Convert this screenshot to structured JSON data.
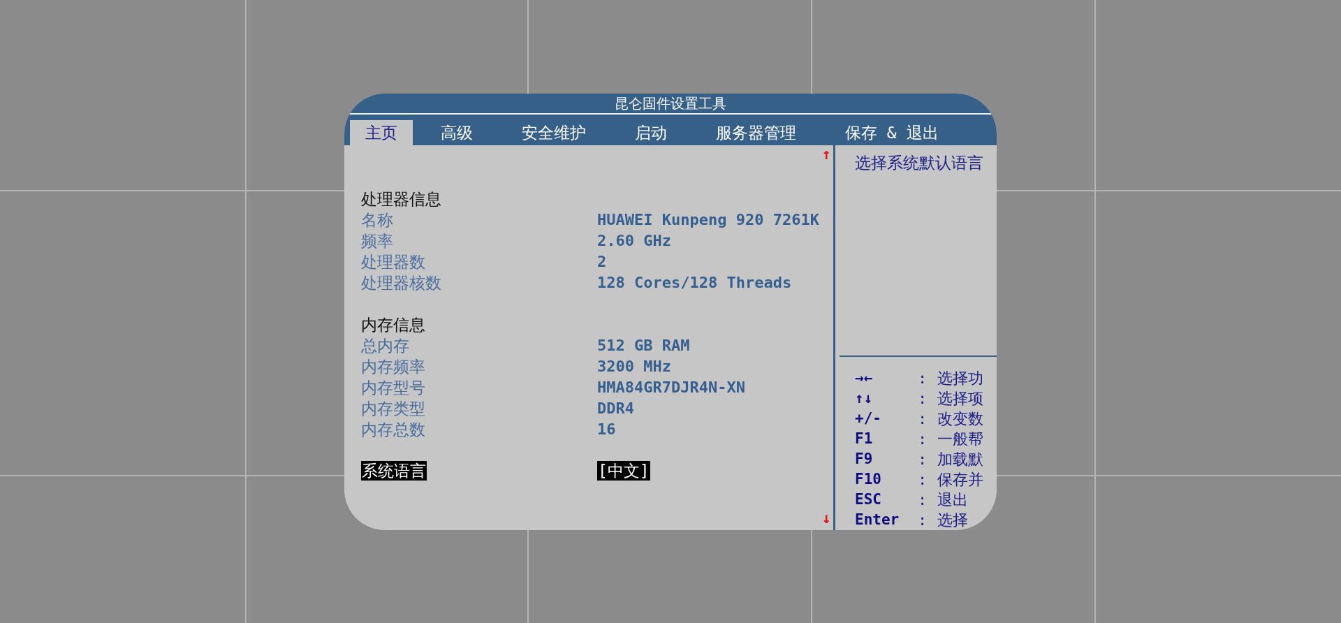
{
  "window": {
    "title": "昆仑固件设置工具"
  },
  "tabs": [
    {
      "label": "主页",
      "selected": true
    },
    {
      "label": "高级",
      "selected": false
    },
    {
      "label": "安全维护",
      "selected": false
    },
    {
      "label": "启动",
      "selected": false
    },
    {
      "label": "服务器管理",
      "selected": false
    },
    {
      "label": "保存 & 退出",
      "selected": false
    }
  ],
  "sections": [
    {
      "heading": "处理器信息",
      "rows": [
        {
          "label": "名称",
          "value": "HUAWEI Kunpeng 920 7261K"
        },
        {
          "label": "频率",
          "value": "2.60 GHz"
        },
        {
          "label": "处理器数",
          "value": "2"
        },
        {
          "label": "处理器核数",
          "value": "128 Cores/128 Threads"
        }
      ]
    },
    {
      "heading": "内存信息",
      "rows": [
        {
          "label": "总内存",
          "value": "512 GB RAM"
        },
        {
          "label": "内存频率",
          "value": "3200 MHz"
        },
        {
          "label": "内存型号",
          "value": "HMA84GR7DJR4N-XN"
        },
        {
          "label": "内存类型",
          "value": "DDR4"
        },
        {
          "label": "内存总数",
          "value": "16"
        }
      ]
    }
  ],
  "setting": {
    "label": "系统语言",
    "value": "[中文]",
    "selected": true
  },
  "scroll": {
    "up": "↑",
    "down": "↓"
  },
  "help_text": "选择系统默认语言",
  "keys": [
    {
      "key": "→←",
      "separator": ":",
      "desc": "选择功"
    },
    {
      "key": "↑↓",
      "separator": ":",
      "desc": "选择项"
    },
    {
      "key": "+/-",
      "separator": ":",
      "desc": "改变数"
    },
    {
      "key": "F1",
      "separator": ":",
      "desc": "一般帮"
    },
    {
      "key": "F9",
      "separator": ":",
      "desc": "加载默"
    },
    {
      "key": "F10",
      "separator": ":",
      "desc": "保存并"
    },
    {
      "key": "ESC",
      "separator": ":",
      "desc": "退出"
    },
    {
      "key": "Enter",
      "separator": ":",
      "desc": "选择"
    }
  ]
}
